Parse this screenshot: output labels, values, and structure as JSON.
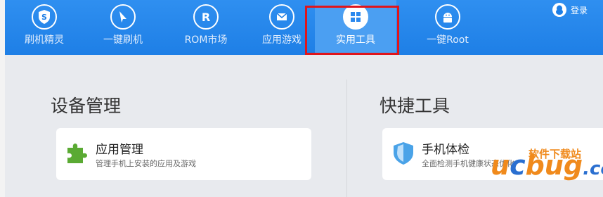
{
  "nav": {
    "items": [
      {
        "label": "刷机精灵",
        "icon": "shield-s-icon"
      },
      {
        "label": "一键刷机",
        "icon": "cursor-arrow-icon"
      },
      {
        "label": "ROM市场",
        "icon": "r-letter-icon"
      },
      {
        "label": "应用游戏",
        "icon": "envelope-icon"
      },
      {
        "label": "实用工具",
        "icon": "grid-icon"
      },
      {
        "label": "一键Root",
        "icon": "android-icon"
      }
    ],
    "active_index": 4,
    "login_label": "登录"
  },
  "sections": {
    "device": {
      "title": "设备管理",
      "card": {
        "title": "应用管理",
        "desc": "管理手机上安装的应用及游戏",
        "icon": "puzzle-icon"
      }
    },
    "quick": {
      "title": "快捷工具",
      "card": {
        "title": "手机体检",
        "desc": "全面检测手机健康状态优化",
        "icon": "shield-check-icon"
      }
    }
  },
  "watermark": {
    "line1": "软件下载站",
    "brand_u": "u",
    "brand_c": "c",
    "brand_rest": "bug",
    "tld": ".cc"
  },
  "colors": {
    "accent": "#1e7fe6",
    "highlight": "#e0151b",
    "puzzle": "#5aaa33",
    "shield": "#4aa3e8",
    "wm_orange": "#f08a1c",
    "wm_blue": "#2a6fd0"
  }
}
